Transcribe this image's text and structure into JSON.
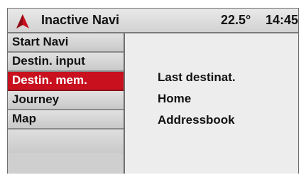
{
  "header": {
    "title": "Inactive Navi",
    "temperature": "22.5°",
    "time": "14:45",
    "icon": "navigation-arrow-icon",
    "icon_color": "#c8101e"
  },
  "sidebar": {
    "items": [
      {
        "label": "Start Navi"
      },
      {
        "label": "Destin. input"
      },
      {
        "label": "Destin. mem."
      },
      {
        "label": "Journey"
      },
      {
        "label": "Map"
      }
    ],
    "selected_label": "Destin. mem.",
    "selected_color": "#c8101e"
  },
  "content": {
    "options": [
      {
        "label": "Last destinat."
      },
      {
        "label": "Home"
      },
      {
        "label": "Addressbook"
      }
    ]
  }
}
